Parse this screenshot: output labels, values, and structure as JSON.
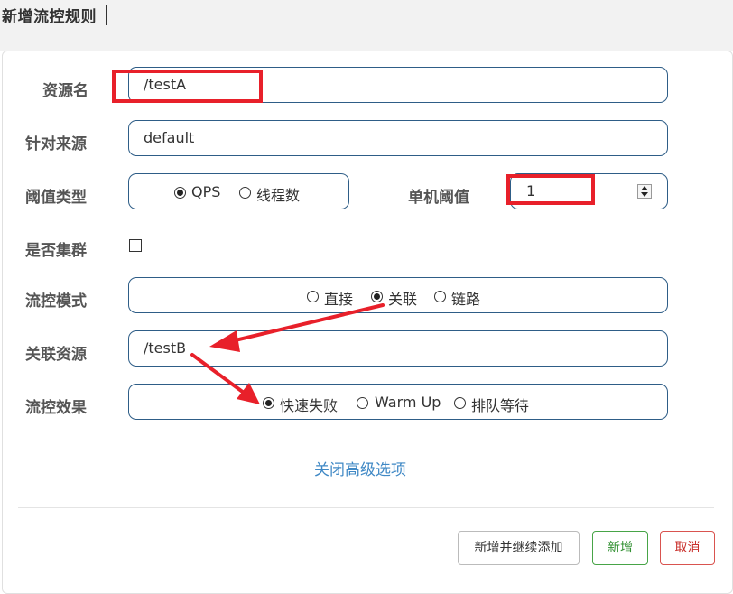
{
  "dialog": {
    "title": "新增流控规则"
  },
  "form": {
    "resource": {
      "label": "资源名",
      "value": "/testA"
    },
    "limit_app": {
      "label": "针对来源",
      "value": "default"
    },
    "threshold_type": {
      "label": "阈值类型",
      "options": [
        "QPS",
        "线程数"
      ],
      "selected": "QPS"
    },
    "threshold": {
      "label": "单机阈值",
      "value": "1"
    },
    "cluster": {
      "label": "是否集群",
      "checked": false
    },
    "strategy": {
      "label": "流控模式",
      "options": [
        "直接",
        "关联",
        "链路"
      ],
      "selected": "关联"
    },
    "ref_resource": {
      "label": "关联资源",
      "value": "/testB"
    },
    "control_behavior": {
      "label": "流控效果",
      "options": [
        "快速失败",
        "Warm Up",
        "排队等待"
      ],
      "selected": "快速失败"
    }
  },
  "advanced_toggle": "关闭高级选项",
  "buttons": {
    "add_continue": "新增并继续添加",
    "add": "新增",
    "cancel": "取消"
  },
  "colors": {
    "annotation_red": "#e8202a",
    "accent_blue": "#3f88c5",
    "input_border": "#2e5d87"
  }
}
